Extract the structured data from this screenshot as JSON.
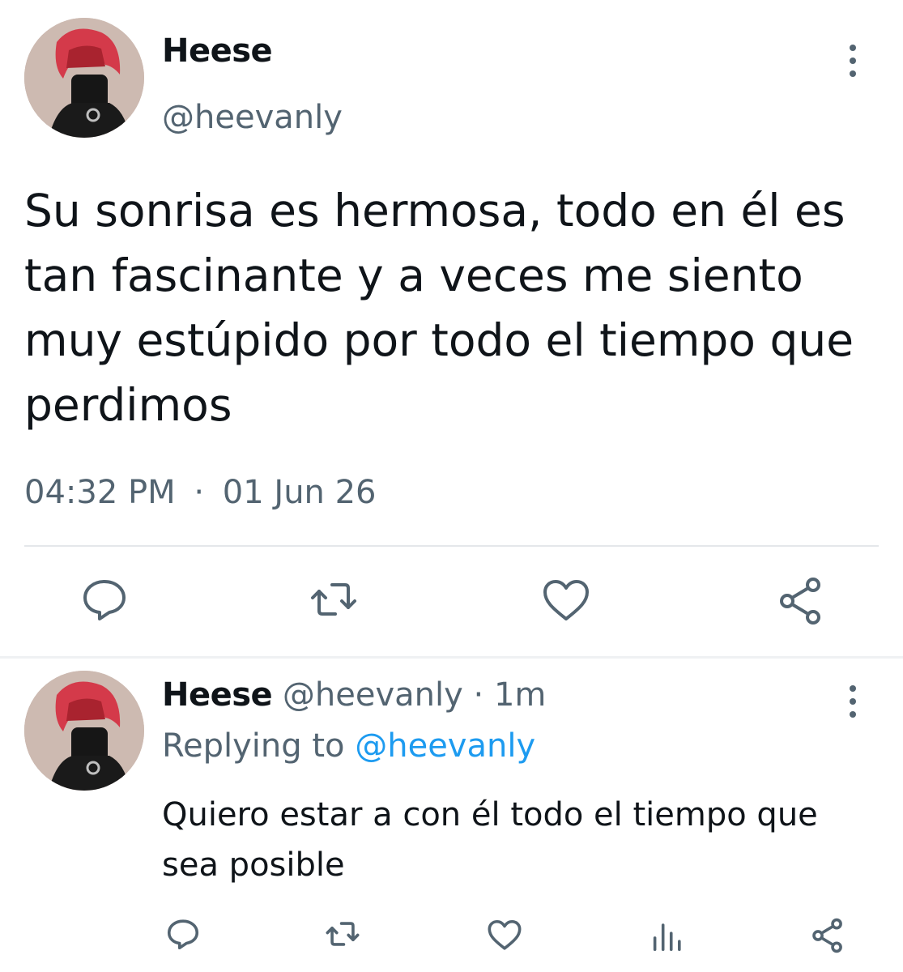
{
  "main_tweet": {
    "author": {
      "name": "Heese",
      "handle": "@heevanly",
      "avatar": "profile-photo"
    },
    "text": "Su sonrisa es hermosa, todo en él es tan fascinante y a veces me siento muy estúpido por todo el tiempo que perdimos",
    "time": "04:32 PM",
    "separator": "·",
    "date": "01 Jun 26",
    "actions": [
      "reply-icon",
      "retweet-icon",
      "like-icon",
      "share-icon"
    ],
    "menu_icon": "more-vertical-icon"
  },
  "reply_tweet": {
    "author": {
      "name": "Heese",
      "handle": "@heevanly",
      "avatar": "profile-photo"
    },
    "separator": "·",
    "age": "1m",
    "replying_prefix": "Replying to",
    "replying_to": "@heevanly",
    "text": "Quiero estar a con él todo el tiempo que sea posible",
    "actions": [
      "reply-icon",
      "retweet-icon",
      "like-icon",
      "analytics-icon",
      "share-icon"
    ],
    "menu_icon": "more-vertical-icon"
  },
  "colors": {
    "text_primary": "#0f1419",
    "text_secondary": "#536471",
    "link": "#1d9bf0",
    "divider": "#e4e7ea",
    "avatar_hair": "#d43a4a"
  }
}
